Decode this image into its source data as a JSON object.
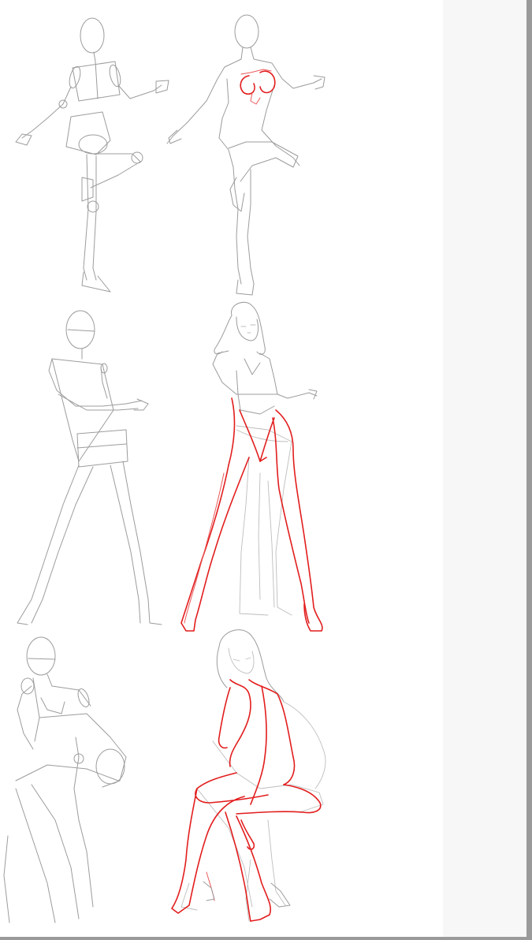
{
  "image": {
    "subject": "figure-drawing-tutorial-steps",
    "rows": [
      {
        "row": 1,
        "left": "mannequin-standing-one-leg",
        "right": "figure-outline-standing-one-leg"
      },
      {
        "row": 2,
        "left": "mannequin-wide-stance",
        "right": "figure-in-dress-wide-stance"
      },
      {
        "row": 3,
        "left": "mannequin-seated",
        "right": "figure-seated-hand-on-cheek"
      }
    ]
  },
  "colors": {
    "sketch_gray": "#9c9c9c",
    "sketch_light": "#bdbdbd",
    "highlight_red": "#e21d1d",
    "panel_bg": "#f7f7f7",
    "scrollbar": "#9a9a9a"
  }
}
